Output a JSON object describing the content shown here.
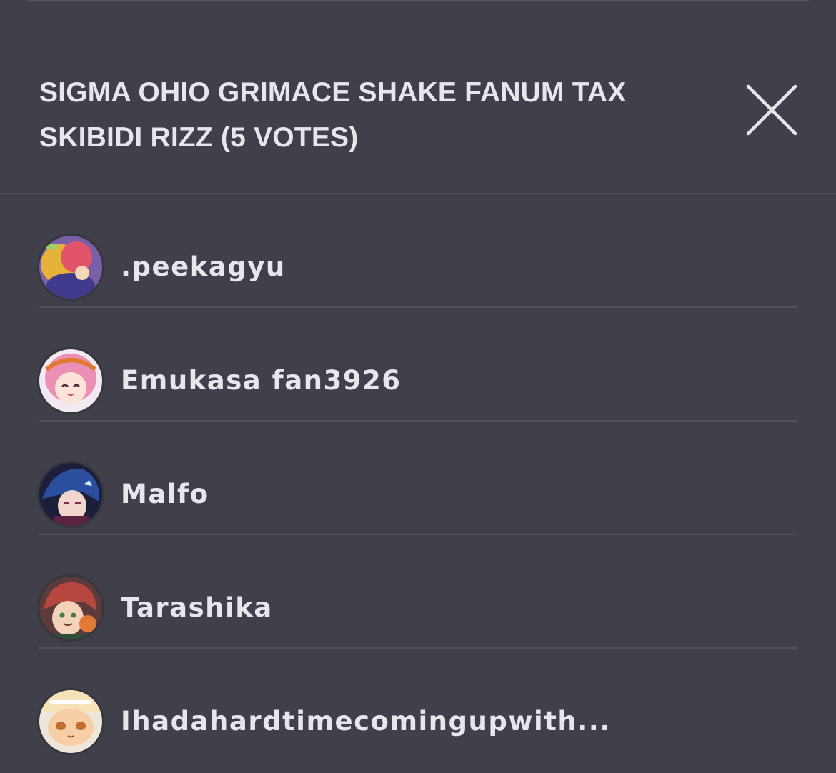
{
  "header": {
    "title": "SIGMA OHIO GRIMACE SHAKE FANUM TAX SKIBIDI RIZZ (5 VOTES)",
    "close_icon": "close-icon"
  },
  "voters": [
    {
      "name": ".peekagyu",
      "avatar_icon": "avatar-image"
    },
    {
      "name": "Emukasa fan3926",
      "avatar_icon": "avatar-image"
    },
    {
      "name": "Malfo",
      "avatar_icon": "avatar-image"
    },
    {
      "name": "Tarashika",
      "avatar_icon": "avatar-image"
    },
    {
      "name": "Ihadahardtimecomingupwith...",
      "avatar_icon": "avatar-image"
    }
  ],
  "colors": {
    "background": "#40404b",
    "text": "#e6e6ec",
    "divider": "#52525d"
  }
}
